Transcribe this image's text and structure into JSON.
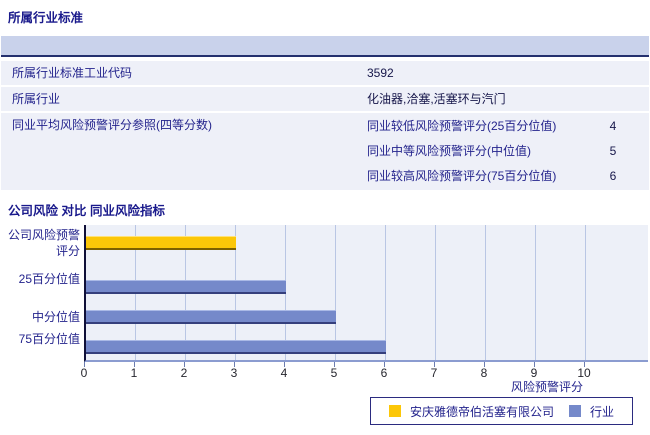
{
  "industry_section": {
    "title": "所属行业标准",
    "rows": [
      {
        "label": "所属行业标准工业代码",
        "value": "3592"
      },
      {
        "label": "所属行业",
        "value": "化油器,洽塞,活塞环与汽门"
      },
      {
        "label": "同业平均风险预警评分参照(四等分数)",
        "value": ""
      }
    ],
    "quartile_rows": [
      {
        "label": "同业较低风险预警评分(25百分位值)",
        "value": "4"
      },
      {
        "label": "同业中等风险预警评分(中位值)",
        "value": "5"
      },
      {
        "label": "同业较高风险预警评分(75百分位值)",
        "value": "6"
      }
    ]
  },
  "comparison_section": {
    "title": "公司风险 对比 同业风险指标"
  },
  "chart_data": {
    "type": "bar",
    "orientation": "horizontal",
    "categories": [
      "公司风险预警评分",
      "25百分位值",
      "中分位值",
      "75百分位值"
    ],
    "values": [
      3,
      4,
      5,
      6
    ],
    "bar_series": [
      "company",
      "industry",
      "industry",
      "industry"
    ],
    "title": "",
    "xlabel": "风险预警评分",
    "ylabel": "",
    "xlim": [
      0,
      11.2
    ],
    "ticks": [
      0,
      1,
      2,
      3,
      4,
      5,
      6,
      7,
      8,
      9,
      10
    ],
    "grid": true,
    "colors": {
      "company": "#FCC708",
      "industry": "#7589CA"
    },
    "legend": {
      "position": "bottom-right",
      "entries": [
        {
          "series": "company",
          "label": "安庆雅德帝伯活塞有限公司",
          "color": "#FCC708"
        },
        {
          "series": "industry",
          "label": "行业",
          "color": "#7589CA"
        }
      ]
    }
  }
}
